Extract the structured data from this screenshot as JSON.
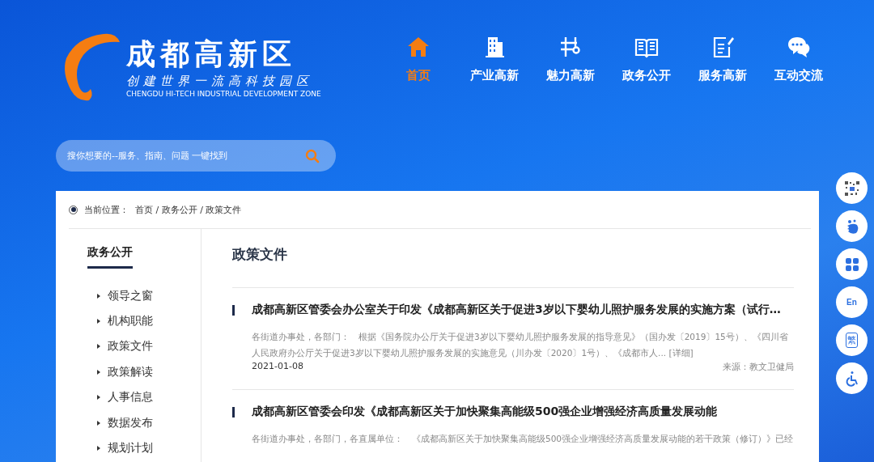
{
  "logo": {
    "title": "成都高新区",
    "slogan": "创建世界一流高科技园区",
    "english": "CHENGDU HI-TECH INDUSTRIAL DEVELOPMENT ZONE"
  },
  "nav": [
    {
      "label": "首页",
      "selected": true
    },
    {
      "label": "产业高新",
      "selected": false
    },
    {
      "label": "魅力高新",
      "selected": false
    },
    {
      "label": "政务公开",
      "selected": false
    },
    {
      "label": "服务高新",
      "selected": false
    },
    {
      "label": "互动交流",
      "selected": false
    }
  ],
  "search": {
    "placeholder": "搜你想要的--服务、指南、问题 一键找到"
  },
  "breadcrumb": {
    "label": "当前位置：",
    "path": "首页 / 政务公开 / 政策文件"
  },
  "sidebar": {
    "title": "政务公开",
    "items": [
      {
        "label": "领导之窗"
      },
      {
        "label": "机构职能"
      },
      {
        "label": "政策文件"
      },
      {
        "label": "政策解读"
      },
      {
        "label": "人事信息"
      },
      {
        "label": "数据发布"
      },
      {
        "label": "规划计划"
      }
    ]
  },
  "section_title": "政策文件",
  "articles": [
    {
      "title": "成都高新区管委会办公室关于印发《成都高新区关于促进3岁以下婴幼儿照护服务发展的实施方案（试行…",
      "summary": "各街道办事处，各部门：　根据《国务院办公厅关于促进3岁以下婴幼儿照护服务发展的指导意见》（国办发〔2019〕15号）、《四川省人民政府办公厅关于促进3岁以下婴幼儿照护服务发展的实施意见（川办发〔2020〕1号）、《成都市人...",
      "more": "[详细]",
      "date": "2021-01-08",
      "source": "来源：教文卫健局"
    },
    {
      "title": "成都高新区管委会印发《成都高新区关于加快聚集高能级500强企业增强经济高质量发展动能",
      "summary": "各街道办事处，各部门，各直属单位：　《成都高新区关于加快聚集高能级500强企业增强经济高质量发展动能的若干政策（修订）》已经"
    }
  ],
  "side_tools": [
    {
      "kind": "qr"
    },
    {
      "kind": "mascot"
    },
    {
      "kind": "apps"
    },
    {
      "kind": "text",
      "label": "En"
    },
    {
      "kind": "boxed",
      "label": "繁"
    },
    {
      "kind": "accessibility"
    }
  ]
}
